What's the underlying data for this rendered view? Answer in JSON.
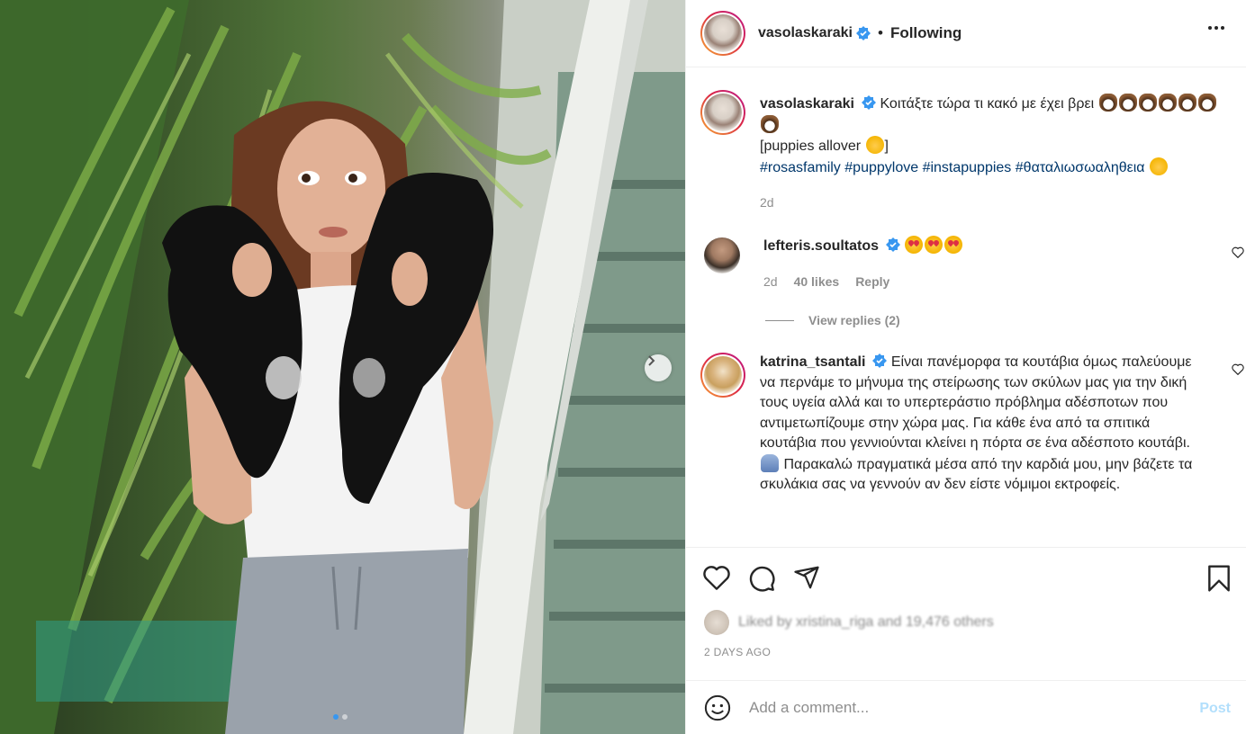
{
  "post": {
    "author": "vasolaskaraki",
    "follow_status": "Following",
    "separator": "•",
    "caption": {
      "line1": "Κοιτάξτε τώρα τι κακό με έχει βρει",
      "line2": "[puppies allover",
      "line2_end": "]",
      "hashtags": [
        "#rosasfamily",
        "#puppylove",
        "#instapuppies",
        "#θαταλιωσωαληθεια"
      ],
      "time": "2d"
    },
    "likes_text": "Liked by xristina_riga and 19,476 others",
    "timestamp": "2 DAYS AGO",
    "icons": [
      "more-icon",
      "heart-icon",
      "comment-icon",
      "share-icon",
      "bookmark-icon",
      "emoji-icon",
      "chevron-right-icon",
      "verified-icon"
    ]
  },
  "comments": [
    {
      "username": "lefteris.soultatos",
      "text": "",
      "time": "2d",
      "likes": "40 likes",
      "reply_label": "Reply"
    },
    {
      "username": "katrina_tsantali",
      "text": "Είναι πανέμορφα τα κουτάβια όμως παλεύουμε να περνάμε το μήνυμα της στείρωσης των σκύλων μας για την δική τους υγεία αλλά και το υπερτεράστιο πρόβλημα αδέσποτων που αντιμετωπίζουμε στην χώρα μας. Για κάθε ένα από τα σπιτικά κουτάβια που γεννιούνται κλείνει η πόρτα σε ένα αδέσποτο κουτάβι.",
      "text2": "Παρακαλώ πραγματικά μέσα από την καρδιά μου, μην βάζετε τα σκυλάκια σας να γεννούν αν δεν είστε νόμιμοι εκτροφείς."
    }
  ],
  "view_replies": "View replies (2)",
  "add_comment": {
    "placeholder": "Add a comment...",
    "post_label": "Post"
  },
  "colors": {
    "verified": "#3897f0",
    "link": "#00376b",
    "muted": "#8e8e8e",
    "post_disabled": "#b2dffc"
  }
}
